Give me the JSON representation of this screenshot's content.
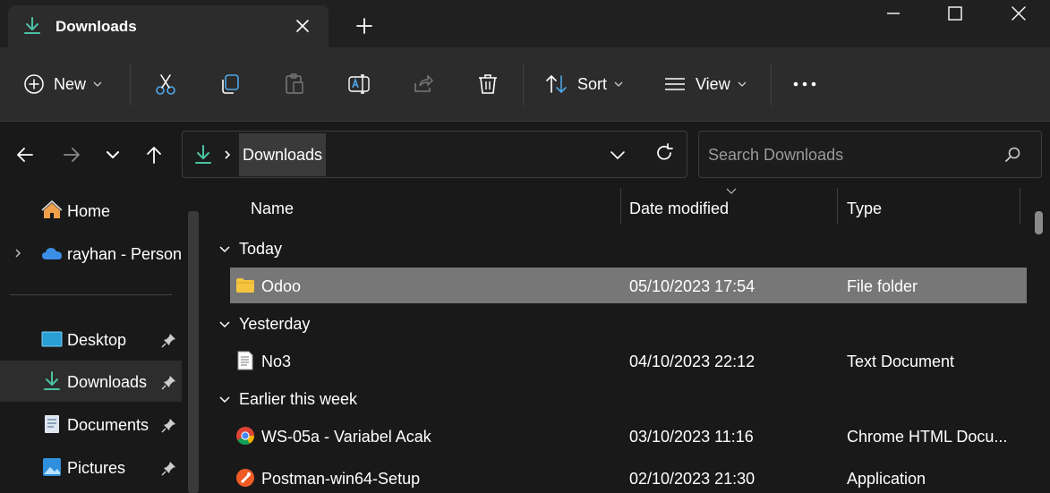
{
  "tab": {
    "title": "Downloads"
  },
  "toolbar": {
    "new_label": "New",
    "sort_label": "Sort",
    "view_label": "View"
  },
  "address": {
    "crumb": "Downloads"
  },
  "search": {
    "placeholder": "Search Downloads"
  },
  "sidebar": {
    "items": [
      {
        "label": "Home"
      },
      {
        "label": "rayhan - Personal"
      },
      {
        "label": "Desktop"
      },
      {
        "label": "Downloads"
      },
      {
        "label": "Documents"
      },
      {
        "label": "Pictures"
      }
    ]
  },
  "columns": {
    "name": "Name",
    "date": "Date modified",
    "type": "Type"
  },
  "groups": [
    {
      "label": "Today"
    },
    {
      "label": "Yesterday"
    },
    {
      "label": "Earlier this week"
    }
  ],
  "files": [
    {
      "name": "Odoo",
      "date": "05/10/2023 17:54",
      "type": "File folder",
      "icon": "folder-icon"
    },
    {
      "name": "No3",
      "date": "04/10/2023 22:12",
      "type": "Text Document",
      "icon": "text-document-icon"
    },
    {
      "name": "WS-05a - Variabel Acak",
      "date": "03/10/2023 11:16",
      "type": "Chrome HTML Docu...",
      "icon": "chrome-icon"
    },
    {
      "name": "Postman-win64-Setup",
      "date": "02/10/2023 21:30",
      "type": "Application",
      "icon": "postman-icon"
    }
  ],
  "colors": {
    "accent": "#4cc2a4",
    "folder": "#f5c542",
    "selected_row": "#777777",
    "onedrive": "#3b8ee6",
    "home": "#f0a04b"
  }
}
